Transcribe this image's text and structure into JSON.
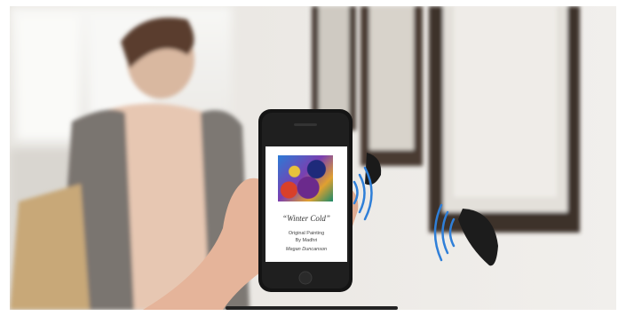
{
  "phone_screen": {
    "artwork_title": "“Winter Cold”",
    "line1": "Original Painting",
    "line2": "By Madhri",
    "line3": "Megan Duncanson"
  },
  "icons": {
    "bluetooth": "snowflake/bluetooth-icon",
    "signal": "wireless-signal-icon"
  },
  "colors": {
    "signal_blue": "#2f7fd8",
    "beacon": "#1c1c1c",
    "frame": "#4a3a30"
  }
}
